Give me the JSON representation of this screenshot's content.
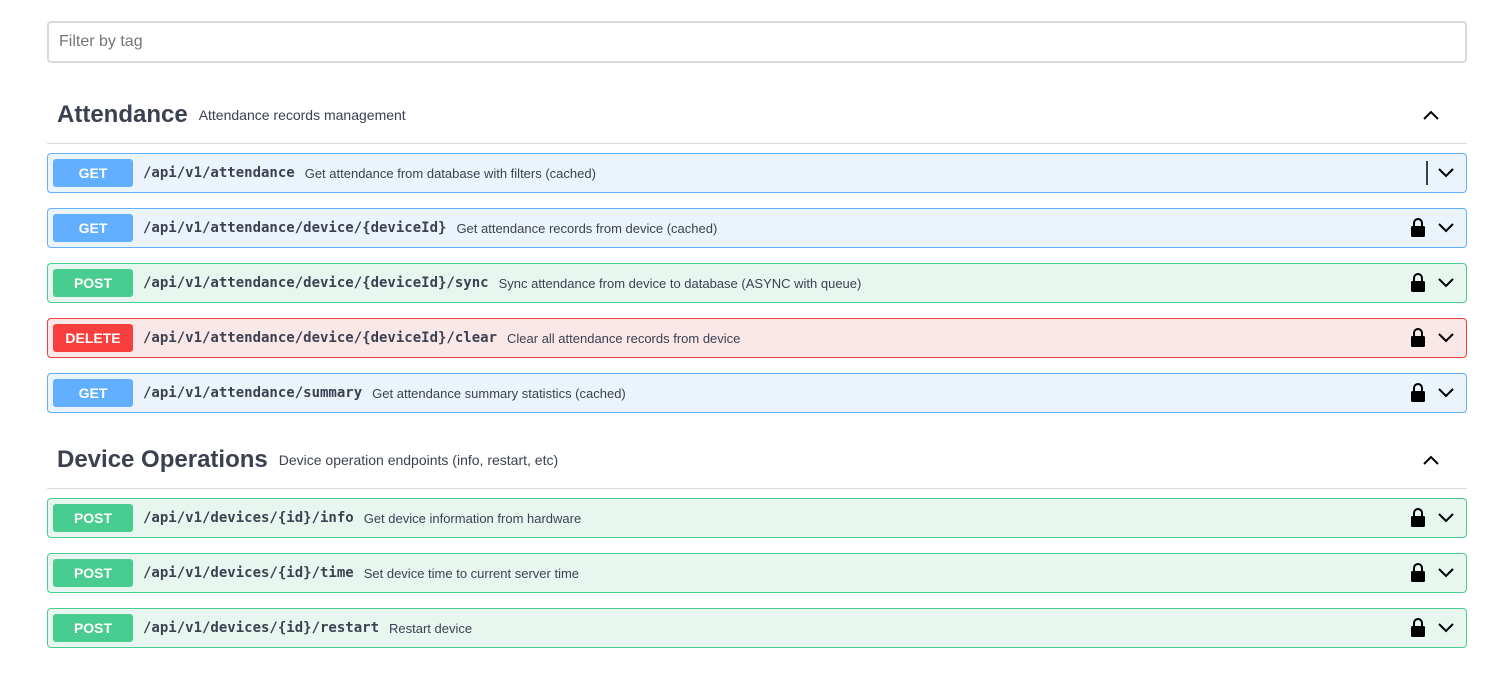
{
  "filter": {
    "placeholder": "Filter by tag",
    "value": ""
  },
  "tags": [
    {
      "name": "Attendance",
      "description": "Attendance records management",
      "expanded": true,
      "operations": [
        {
          "method": "GET",
          "path": "/api/v1/attendance",
          "summary": "Get attendance from database with filters (cached)",
          "locked": false
        },
        {
          "method": "GET",
          "path": "/api/v1/attendance/device/{deviceId}",
          "summary": "Get attendance records from device (cached)",
          "locked": true
        },
        {
          "method": "POST",
          "path": "/api/v1/attendance/device/{deviceId}/sync",
          "summary": "Sync attendance from device to database (ASYNC with queue)",
          "locked": true
        },
        {
          "method": "DELETE",
          "path": "/api/v1/attendance/device/{deviceId}/clear",
          "summary": "Clear all attendance records from device",
          "locked": true
        },
        {
          "method": "GET",
          "path": "/api/v1/attendance/summary",
          "summary": "Get attendance summary statistics (cached)",
          "locked": true
        }
      ]
    },
    {
      "name": "Device Operations",
      "description": "Device operation endpoints (info, restart, etc)",
      "expanded": true,
      "operations": [
        {
          "method": "POST",
          "path": "/api/v1/devices/{id}/info",
          "summary": "Get device information from hardware",
          "locked": true
        },
        {
          "method": "POST",
          "path": "/api/v1/devices/{id}/time",
          "summary": "Set device time to current server time",
          "locked": true
        },
        {
          "method": "POST",
          "path": "/api/v1/devices/{id}/restart",
          "summary": "Restart device",
          "locked": true
        }
      ]
    }
  ],
  "colors": {
    "get": "#61affe",
    "post": "#49cc90",
    "delete": "#f93e3e",
    "text": "#3b4151"
  },
  "icons": {
    "lock": "lock-icon",
    "expand": "chevron-down-icon",
    "collapse": "chevron-up-icon"
  }
}
